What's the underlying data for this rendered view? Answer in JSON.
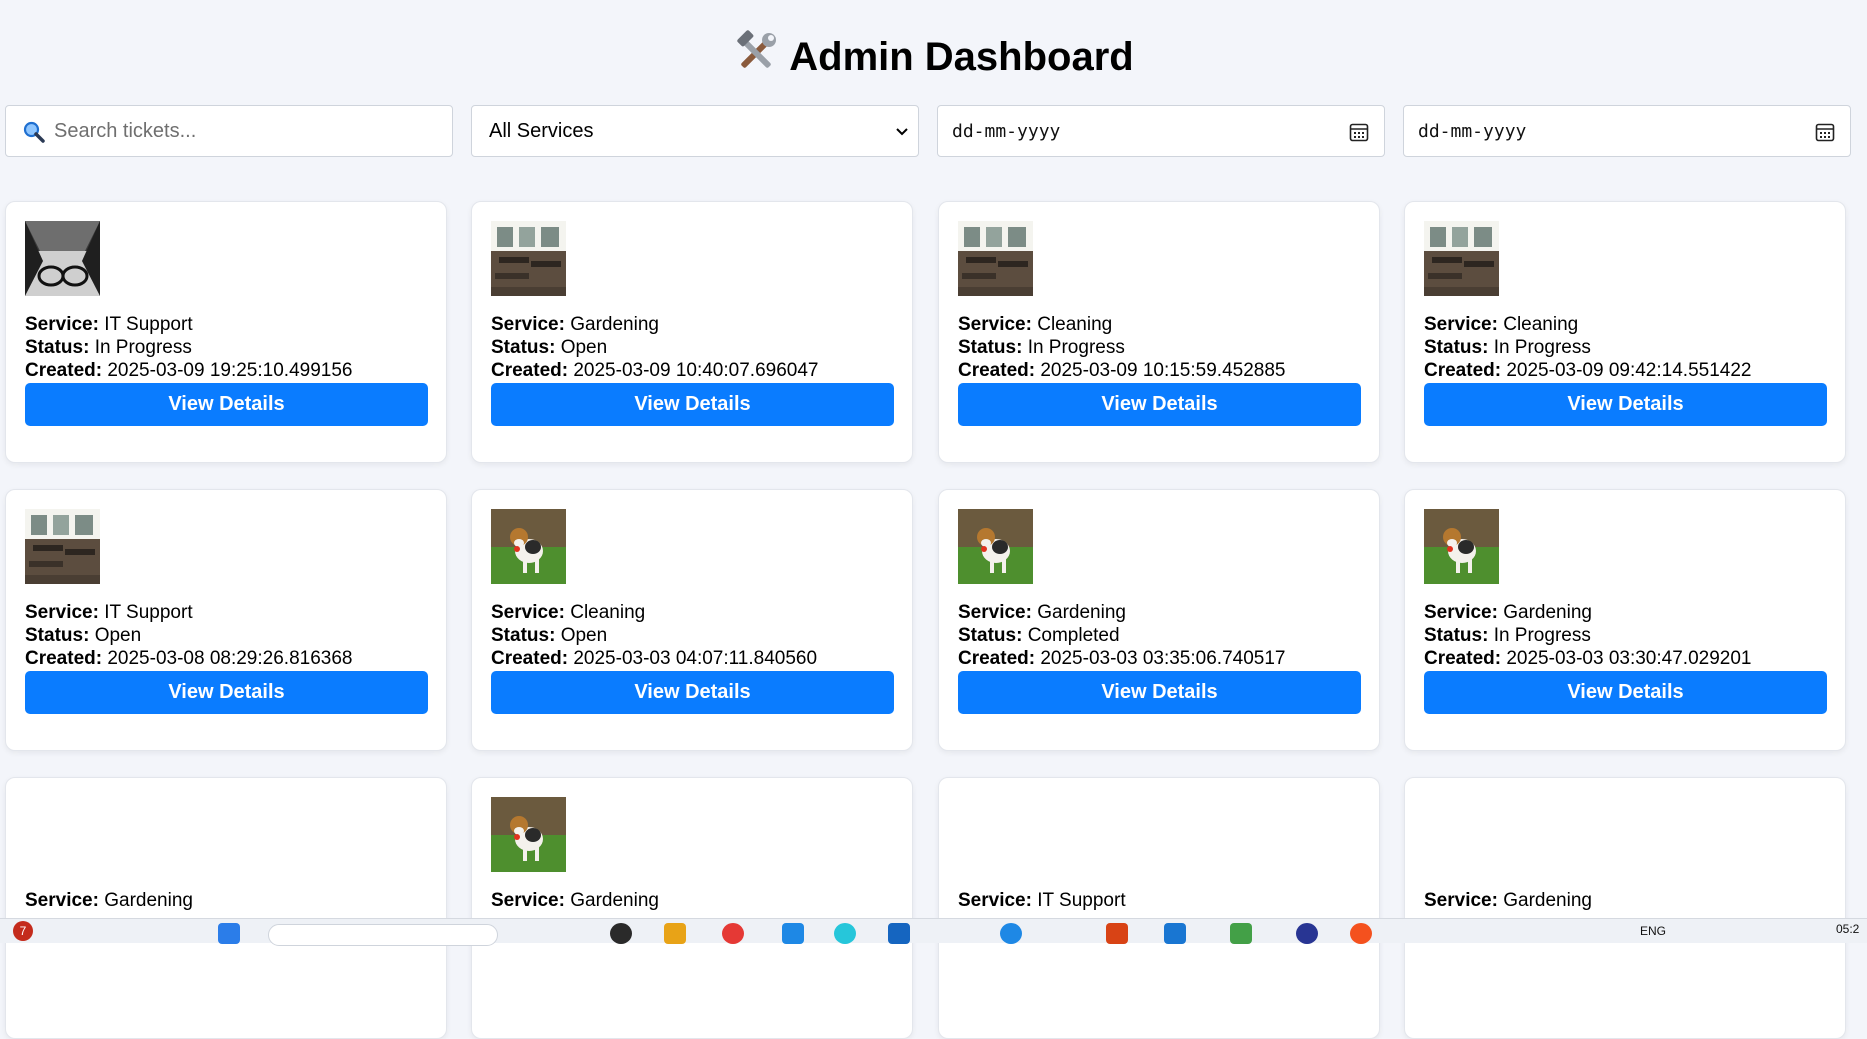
{
  "page": {
    "title": "Admin Dashboard",
    "title_icon": "hammer-and-wrench-icon"
  },
  "filters": {
    "search_placeholder": "Search tickets...",
    "search_icon": "magnifier-icon",
    "service_selected": "All Services",
    "date_from_placeholder": "dd-mm-yyyy",
    "date_to_placeholder": "dd-mm-yyyy"
  },
  "labels": {
    "service": "Service:",
    "status": "Status:",
    "created": "Created:",
    "button": "View Details"
  },
  "tickets": [
    {
      "service": "IT Support",
      "status": "In Progress",
      "created": "2025-03-09 19:25:10.499156",
      "image": "glasses-photo"
    },
    {
      "service": "Gardening",
      "status": "Open",
      "created": "2025-03-09 10:40:07.696047",
      "image": "room-photo"
    },
    {
      "service": "Cleaning",
      "status": "In Progress",
      "created": "2025-03-09 10:15:59.452885",
      "image": "room-photo"
    },
    {
      "service": "Cleaning",
      "status": "In Progress",
      "created": "2025-03-09 09:42:14.551422",
      "image": "room-photo"
    },
    {
      "service": "IT Support",
      "status": "Open",
      "created": "2025-03-08 08:29:26.816368",
      "image": "room-photo"
    },
    {
      "service": "Cleaning",
      "status": "Open",
      "created": "2025-03-03 04:07:11.840560",
      "image": "dog-photo"
    },
    {
      "service": "Gardening",
      "status": "Completed",
      "created": "2025-03-03 03:35:06.740517",
      "image": "dog-photo"
    },
    {
      "service": "Gardening",
      "status": "In Progress",
      "created": "2025-03-03 03:30:47.029201",
      "image": "dog-photo"
    },
    {
      "service": "Gardening",
      "status": "",
      "created": "",
      "image": ""
    },
    {
      "service": "Gardening",
      "status": "",
      "created": "",
      "image": "dog-photo"
    },
    {
      "service": "IT Support",
      "status": "",
      "created": "",
      "image": ""
    },
    {
      "service": "Gardening",
      "status": "",
      "created": "",
      "image": ""
    }
  ],
  "taskbar": {
    "notification_count": "7",
    "language": "ENG",
    "time": "05:2"
  },
  "colors": {
    "accent": "#0a7cff",
    "background": "#f3f5fa"
  }
}
